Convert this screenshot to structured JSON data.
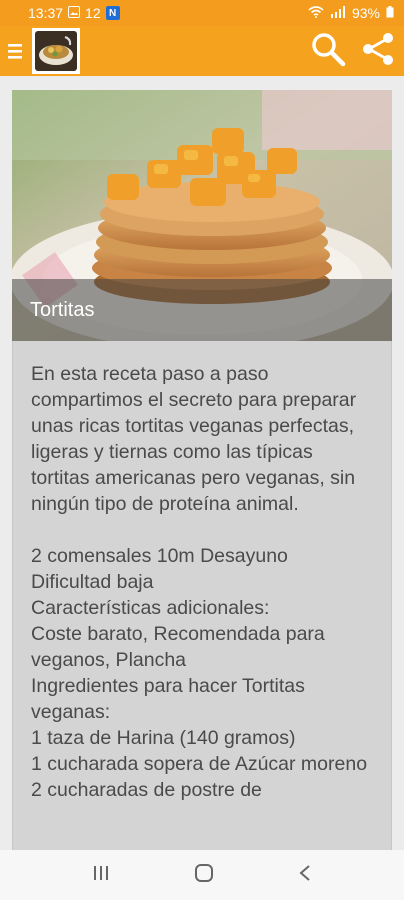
{
  "status": {
    "time": "13:37",
    "notif_count": "12",
    "badge": "N",
    "battery": "93%"
  },
  "appbar": {
    "menu_icon": "menu-icon",
    "search_icon": "search-icon",
    "share_icon": "share-icon",
    "color": "#f5a21e"
  },
  "recipe": {
    "title": "Tortitas",
    "description": "En esta receta paso a paso compartimos el secreto para preparar unas ricas tortitas veganas perfectas, ligeras y tiernas como las típicas tortitas americanas pero veganas, sin ningún tipo de proteína animal.",
    "meta": "2 comensales 10m Desayuno",
    "difficulty": "Dificultad baja",
    "features_label": "Características adicionales:",
    "features": "Coste barato, Recomendada para veganos, Plancha",
    "ingredients_label": "Ingredientes para hacer Tortitas veganas:",
    "ingredients": [
      " 1 taza de Harina (140 gramos)",
      " 1 cucharada sopera de Azúcar moreno",
      " 2 cucharadas de postre de"
    ]
  }
}
